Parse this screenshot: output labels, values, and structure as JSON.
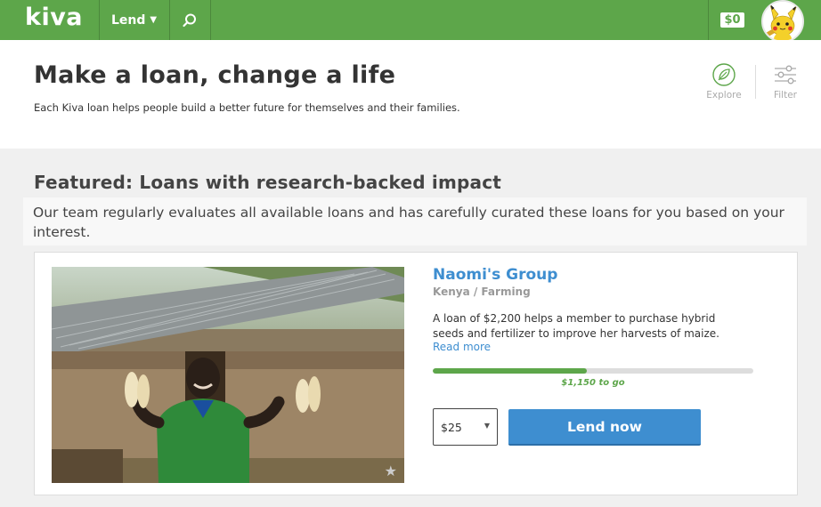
{
  "nav": {
    "logo": "kiva",
    "lend_label": "Lend",
    "balance": "$0"
  },
  "header": {
    "title": "Make a loan, change a life",
    "subtitle": "Each Kiva loan helps people build a better future for themselves and their families.",
    "tools": [
      {
        "label": "Explore",
        "icon": "leaf-icon"
      },
      {
        "label": "Filter",
        "icon": "sliders-icon"
      }
    ]
  },
  "featured": {
    "title": "Featured: Loans with research-backed impact",
    "description": "Our team regularly evaluates all available loans and has carefully curated these loans for you based on your interest."
  },
  "loan": {
    "name": "Naomi's Group",
    "location": "Kenya / Farming",
    "use": "A loan of $2,200 helps a member to purchase hybrid seeds and fertilizer to improve her harvests of maize.",
    "read_more": "Read more",
    "funded_fraction": 0.48,
    "to_go": "$1,150 to go",
    "amount": "$25",
    "lend_label": "Lend now"
  },
  "colors": {
    "brand_green": "#5da64a",
    "link_blue": "#3e8ed0",
    "button_blue": "#3e8ed0"
  }
}
